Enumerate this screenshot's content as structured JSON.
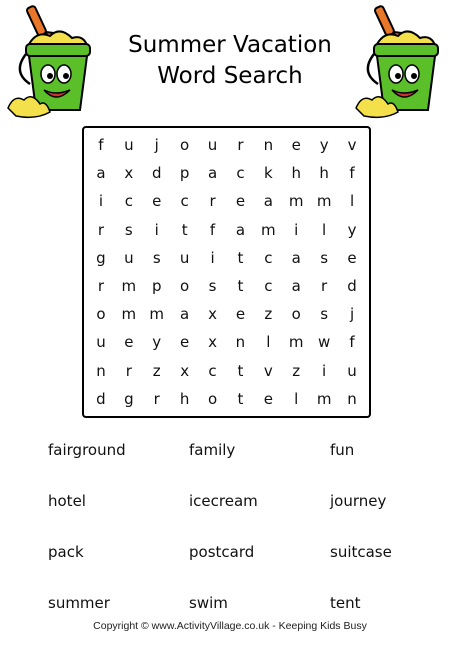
{
  "title": {
    "line1": "Summer Vacation",
    "line2": "Word Search"
  },
  "grid": [
    [
      "f",
      "u",
      "j",
      "o",
      "u",
      "r",
      "n",
      "e",
      "y",
      "v"
    ],
    [
      "a",
      "x",
      "d",
      "p",
      "a",
      "c",
      "k",
      "h",
      "h",
      "f"
    ],
    [
      "i",
      "c",
      "e",
      "c",
      "r",
      "e",
      "a",
      "m",
      "m",
      "l"
    ],
    [
      "r",
      "s",
      "i",
      "t",
      "f",
      "a",
      "m",
      "i",
      "l",
      "y"
    ],
    [
      "g",
      "u",
      "s",
      "u",
      "i",
      "t",
      "c",
      "a",
      "s",
      "e"
    ],
    [
      "r",
      "m",
      "p",
      "o",
      "s",
      "t",
      "c",
      "a",
      "r",
      "d"
    ],
    [
      "o",
      "m",
      "m",
      "a",
      "x",
      "e",
      "z",
      "o",
      "s",
      "j"
    ],
    [
      "u",
      "e",
      "y",
      "e",
      "x",
      "n",
      "l",
      "m",
      "w",
      "f"
    ],
    [
      "n",
      "r",
      "z",
      "x",
      "c",
      "t",
      "v",
      "z",
      "i",
      "u"
    ],
    [
      "d",
      "g",
      "r",
      "h",
      "o",
      "t",
      "e",
      "l",
      "m",
      "n"
    ]
  ],
  "words": [
    "fairground",
    "family",
    "fun",
    "hotel",
    "icecream",
    "journey",
    "pack",
    "postcard",
    "suitcase",
    "summer",
    "swim",
    "tent"
  ],
  "footer": {
    "copyright": "Copyright © www.ActivityVillage.co.uk - Keeping Kids Busy"
  },
  "colors": {
    "bucket_green": "#5bbf2a",
    "bucket_dark": "#2f7d12",
    "sand": "#f3e04a",
    "shovel_orange": "#e8772a"
  },
  "icons": [
    "sand-bucket-icon",
    "sand-bucket-icon"
  ]
}
